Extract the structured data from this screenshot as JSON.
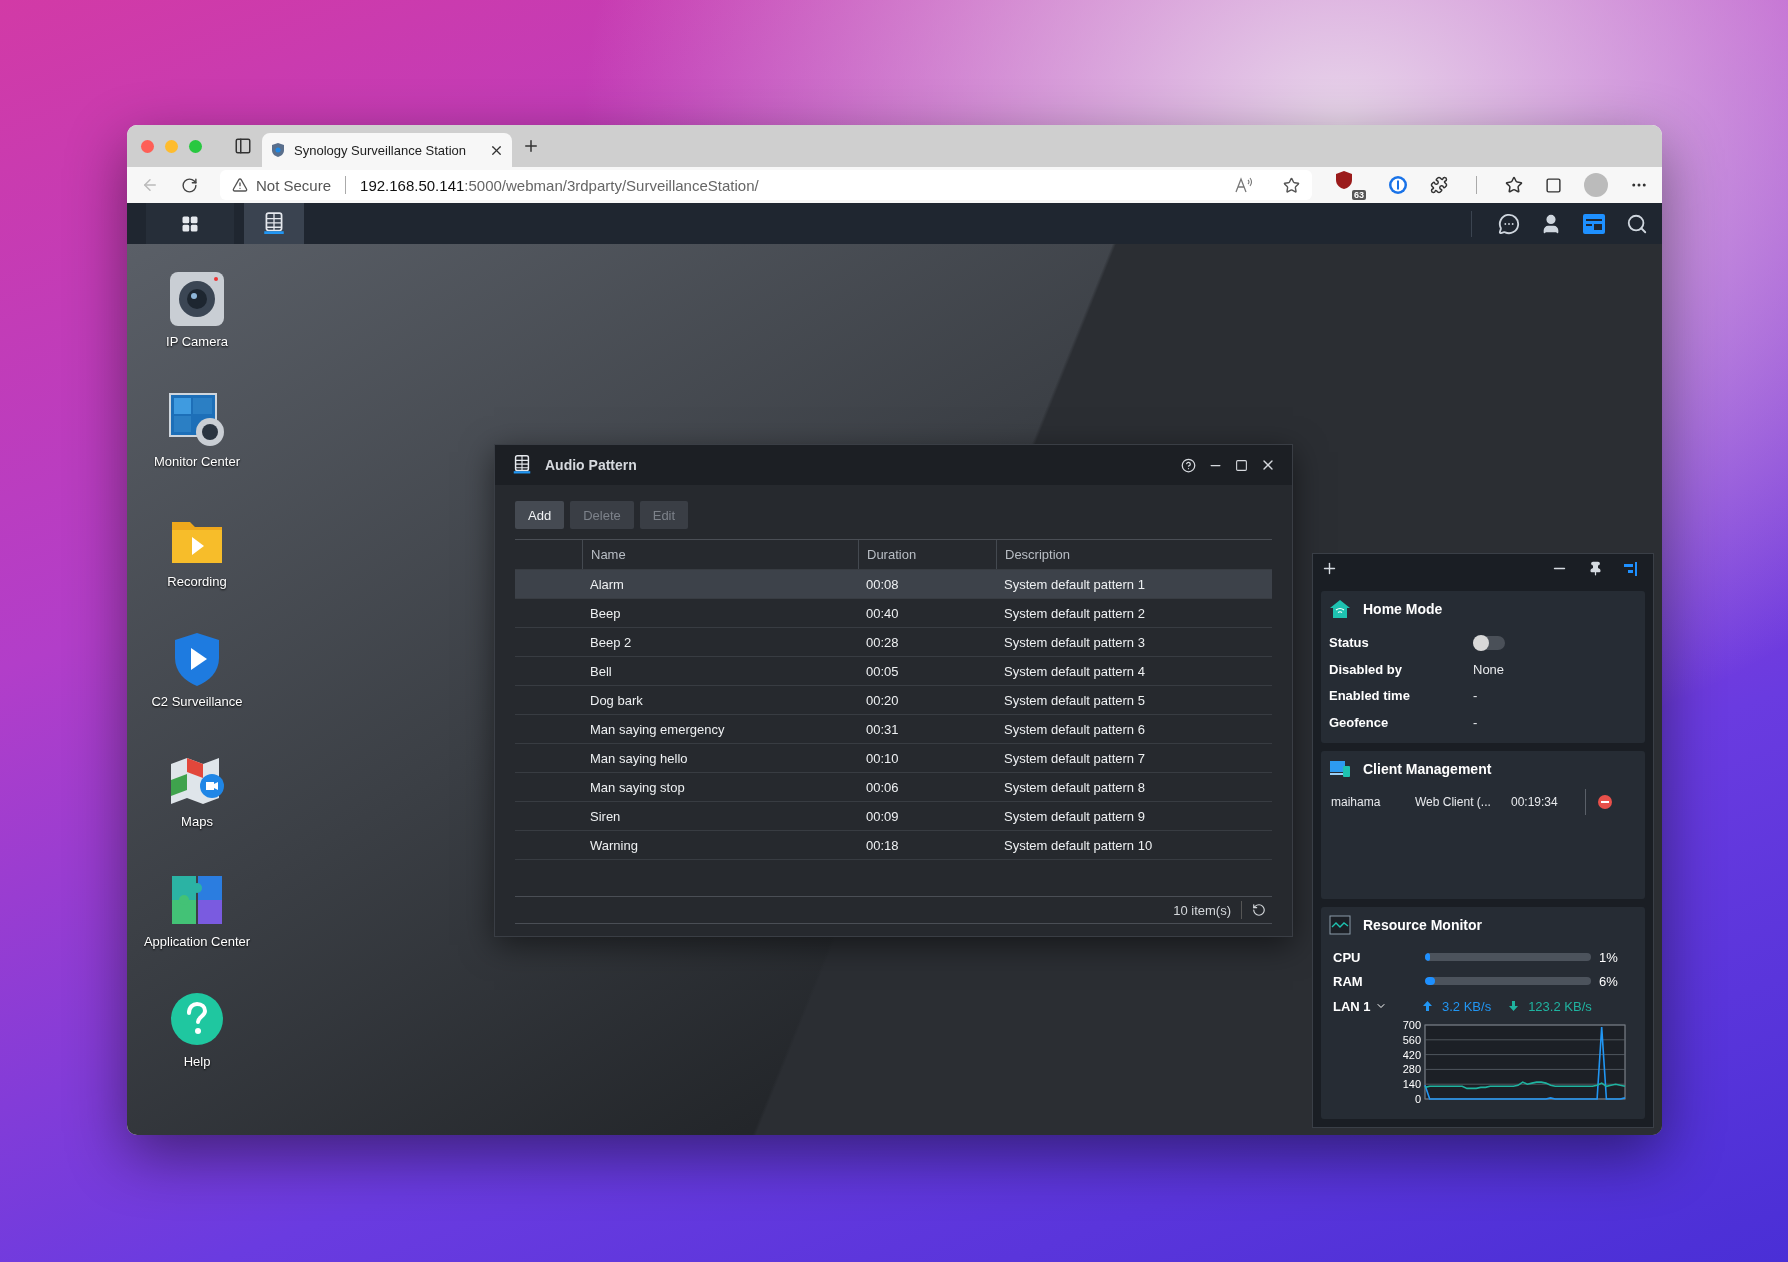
{
  "browser": {
    "tabs": [
      {
        "title": "Synology Surveillance Station",
        "selected": true
      }
    ],
    "address": {
      "security": "Not Secure",
      "host": "192.168.50.141",
      "path": ":5000/webman/3rdparty/SurveillanceStation/"
    },
    "extension_badge": "63"
  },
  "taskbar": {
    "apps": [
      {
        "kind": "main-menu",
        "selected": false
      },
      {
        "kind": "surveillance",
        "selected": true
      }
    ]
  },
  "desktop_icons": [
    {
      "label": "IP Camera",
      "kind": "camera"
    },
    {
      "label": "Monitor Center",
      "kind": "monitor"
    },
    {
      "label": "Recording",
      "kind": "recording"
    },
    {
      "label": "C2 Surveillance",
      "kind": "c2"
    },
    {
      "label": "Maps",
      "kind": "maps"
    },
    {
      "label": "Application Center",
      "kind": "apps"
    },
    {
      "label": "Help",
      "kind": "help"
    }
  ],
  "dialog": {
    "title": "Audio Pattern",
    "buttons": [
      {
        "label": "Add",
        "disabled": false
      },
      {
        "label": "Delete",
        "disabled": true
      },
      {
        "label": "Edit",
        "disabled": true
      }
    ],
    "columns": [
      "Name",
      "Duration",
      "Description"
    ],
    "rows": [
      {
        "name": "Alarm",
        "duration": "00:08",
        "description": "System default pattern 1",
        "selected": true
      },
      {
        "name": "Beep",
        "duration": "00:40",
        "description": "System default pattern 2",
        "selected": false
      },
      {
        "name": "Beep 2",
        "duration": "00:28",
        "description": "System default pattern 3",
        "selected": false
      },
      {
        "name": "Bell",
        "duration": "00:05",
        "description": "System default pattern 4",
        "selected": false
      },
      {
        "name": "Dog bark",
        "duration": "00:20",
        "description": "System default pattern 5",
        "selected": false
      },
      {
        "name": "Man saying emergency",
        "duration": "00:31",
        "description": "System default pattern 6",
        "selected": false
      },
      {
        "name": "Man saying hello",
        "duration": "00:10",
        "description": "System default pattern 7",
        "selected": false
      },
      {
        "name": "Man saying stop",
        "duration": "00:06",
        "description": "System default pattern 8",
        "selected": false
      },
      {
        "name": "Siren",
        "duration": "00:09",
        "description": "System default pattern 9",
        "selected": false
      },
      {
        "name": "Warning",
        "duration": "00:18",
        "description": "System default pattern 10",
        "selected": false
      }
    ],
    "footer": "10 item(s)"
  },
  "widgets": {
    "home_mode": {
      "title": "Home Mode",
      "fields": [
        {
          "label": "Status",
          "kind": "toggle",
          "on": false
        },
        {
          "label": "Disabled by",
          "kind": "text",
          "value": "None"
        },
        {
          "label": "Enabled time",
          "kind": "text",
          "value": "-"
        },
        {
          "label": "Geofence",
          "kind": "text",
          "value": "-"
        }
      ]
    },
    "client_management": {
      "title": "Client Management",
      "clients": [
        {
          "user": "maihama",
          "client": "Web Client (...",
          "time": "00:19:34"
        }
      ]
    },
    "resource_monitor": {
      "title": "Resource Monitor",
      "meters": [
        {
          "label": "CPU",
          "level": 0.01,
          "reading": "1%"
        },
        {
          "label": "RAM",
          "level": 0.06,
          "reading": "6%"
        }
      ],
      "network": {
        "label": "LAN 1",
        "upload": "3.2 KB/s",
        "download": "123.2 KB/s"
      },
      "chart_data": {
        "type": "line",
        "grid": true,
        "ylim": [
          0,
          700
        ],
        "yticks": [
          0,
          140,
          280,
          420,
          560,
          700
        ],
        "series": [
          {
            "color": "#2196f3",
            "values": [
              130,
              0,
              0,
              0,
              0,
              0,
              0,
              0,
              0,
              0,
              0,
              0,
              0,
              0,
              0,
              0,
              0,
              0,
              0,
              0,
              0,
              0,
              0,
              0,
              0,
              0,
              0,
              10,
              0,
              0,
              0,
              0,
              0,
              0,
              0,
              0,
              0,
              0,
              680,
              0,
              0,
              0,
              0,
              10
            ]
          },
          {
            "color": "#1fb3a0",
            "values": [
              110,
              120,
              120,
              120,
              120,
              120,
              120,
              120,
              120,
              100,
              100,
              100,
              110,
              110,
              120,
              120,
              120,
              120,
              120,
              120,
              130,
              160,
              140,
              150,
              160,
              160,
              150,
              130,
              120,
              120,
              120,
              120,
              120,
              120,
              120,
              120,
              120,
              130,
              150,
              120,
              130,
              140,
              130,
              120
            ]
          }
        ]
      }
    }
  }
}
